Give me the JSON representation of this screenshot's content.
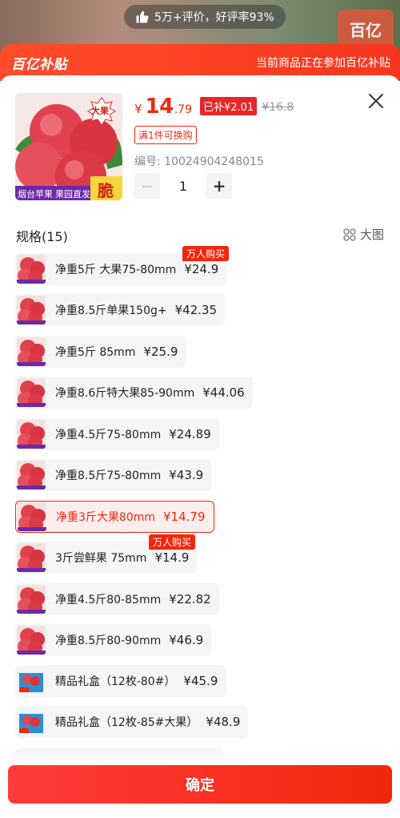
{
  "review_pill": {
    "text": "5万+评价，好评率93%"
  },
  "corner_logo": {
    "text": "百亿"
  },
  "banner": {
    "logo": "百亿补贴",
    "text": "当前商品正在参加百亿补贴"
  },
  "product": {
    "img_tags": {
      "big": "大果",
      "bottom_left": "烟台苹果",
      "bottom_mid": "果园直发",
      "crisp": "脆"
    },
    "price_symbol": "¥",
    "price_int": "14",
    "price_dec": ".79",
    "subsidy": "已补¥2.01",
    "orig_price": "¥16.8",
    "swap_tag": "满1件可换购",
    "sku_no": "编号: 10024904248015",
    "quantity": "1",
    "minus": "−",
    "plus": "+"
  },
  "specs": {
    "title": "规格(15)",
    "big_pic_label": "大图",
    "options": [
      {
        "name": "净重5斤 大果75-80mm",
        "price": "¥24.9",
        "badge": "万人购买"
      },
      {
        "name": "净重8.5斤单果150g+",
        "price": "¥42.35"
      },
      {
        "name": "净重5斤 85mm",
        "price": "¥25.9"
      },
      {
        "name": "净重8.6斤特大果85-90mm",
        "price": "¥44.06"
      },
      {
        "name": "净重4.5斤75-80mm",
        "price": "¥24.89"
      },
      {
        "name": "净重8.5斤75-80mm",
        "price": "¥43.9"
      },
      {
        "name": "净重3斤大果80mm",
        "price": "¥14.79",
        "selected": true
      },
      {
        "name": "3斤尝鲜果 75mm",
        "price": "¥14.9",
        "badge": "万人购买"
      },
      {
        "name": "净重4.5斤80-85mm",
        "price": "¥22.82"
      },
      {
        "name": "净重8.5斤80-90mm",
        "price": "¥46.9"
      },
      {
        "name": "精品礼盒（12枚-80#）",
        "price": "¥45.9",
        "giftbox": true
      },
      {
        "name": "精品礼盒（12枚-85#大果）",
        "price": "¥48.9",
        "giftbox": true
      }
    ]
  },
  "confirm_label": "确定",
  "colors": {
    "accent": "#f2270c",
    "banner": "#f7361f",
    "option_bg": "#f5f5f7"
  }
}
